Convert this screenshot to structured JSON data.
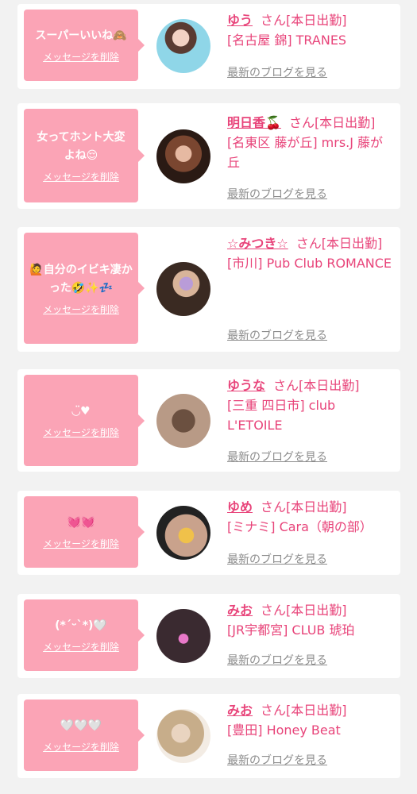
{
  "common": {
    "delete_label": "メッセージを削除",
    "blog_label": "最新のブログを見る",
    "san_suffix": "さん[本日出勤]"
  },
  "colors": {
    "background": "#f2f2f2",
    "card": "#ffffff",
    "bubble": "#fba4b6",
    "name_pink": "#e8447a",
    "link_gray": "#8d8d8d"
  },
  "entries": [
    {
      "message": "スーパーいいね🙈",
      "name": "ゆう",
      "shop": "[名古屋 錦] TRANES",
      "avatar_icon": "photo-avatar-icon"
    },
    {
      "message": "女ってホント大変よね😌",
      "name": "明日香🍒",
      "shop": "[名東区 藤が丘] mrs.J 藤が丘",
      "avatar_icon": "photo-avatar-icon"
    },
    {
      "message": "🙋自分のイビキ凄かった🤣✨💤",
      "name": "☆みつき☆",
      "shop": "[市川] Pub Club ROMANCE",
      "avatar_icon": "photo-avatar-icon"
    },
    {
      "message": "◡̈♥",
      "name": "ゆうな",
      "shop": "[三重 四日市] club L'ETOILE",
      "avatar_icon": "photo-avatar-icon"
    },
    {
      "message": "💓💓",
      "name": "ゆめ",
      "shop": "[ミナミ] Cara（朝の部）",
      "avatar_icon": "photo-avatar-icon"
    },
    {
      "message": "(*ˊᵕˋ*)🤍",
      "name": "みお",
      "shop": "[JR宇都宮] CLUB 琥珀",
      "avatar_icon": "photo-avatar-icon"
    },
    {
      "message": "🤍🤍🤍",
      "name": "みお",
      "shop": "[豊田] Honey Beat",
      "avatar_icon": "photo-avatar-icon"
    }
  ]
}
